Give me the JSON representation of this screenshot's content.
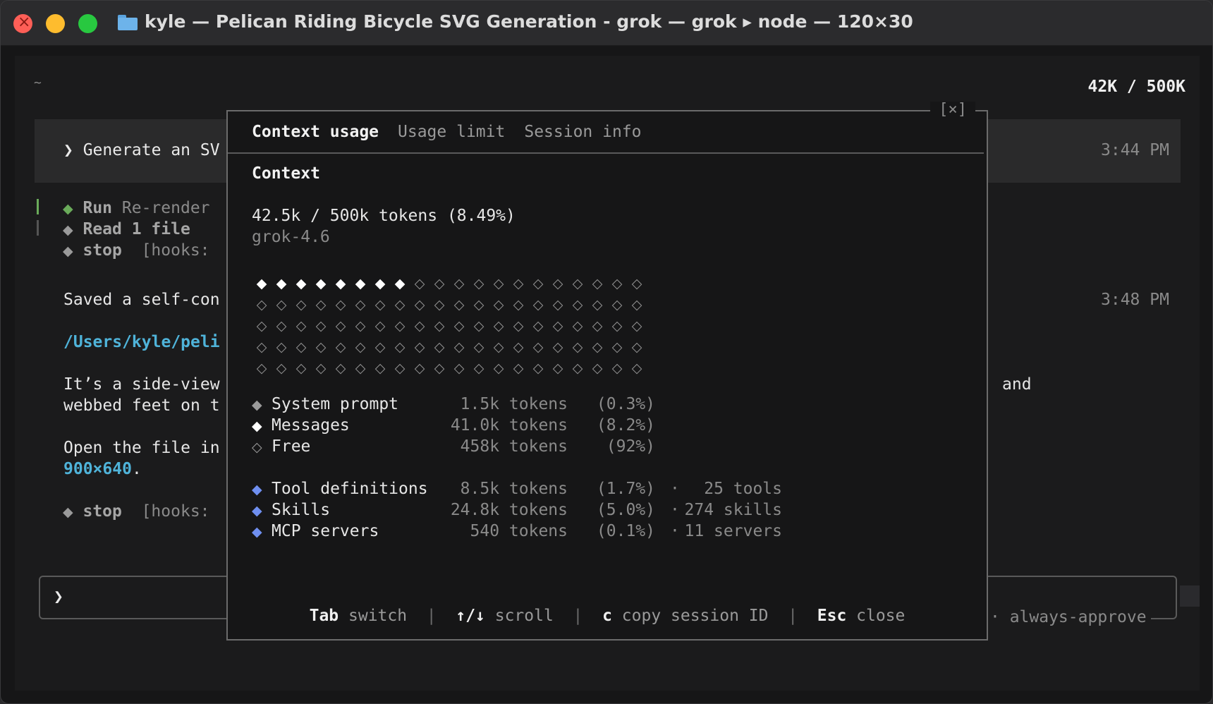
{
  "window": {
    "title": "kyle — Pelican Riding Bicycle SVG Generation - grok — grok ▸ node — 120×30"
  },
  "terminal": {
    "cwd": "~",
    "token_counter": "42K / 500K",
    "user_prompt": "❯ Generate an SV",
    "user_time": "3:44 PM",
    "steps": [
      {
        "verb": "Run",
        "text": "Re-render"
      },
      {
        "verb": "Read 1 file",
        "text": ""
      },
      {
        "verb": "stop",
        "text": "[hooks:"
      }
    ],
    "response_line1": "Saved a self-con",
    "response_time": "3:48 PM",
    "file_path": "/Users/kyle/peli",
    "desc_line1": "It’s a side-view",
    "desc_line1_tail": "and",
    "desc_line2": "webbed feet on t",
    "open_line": "Open the file in",
    "dimensions": "900×640",
    "dimensions_tail": ".",
    "final_stop": {
      "verb": "stop",
      "text": "[hooks:"
    },
    "input_prompt": "❯",
    "mode_label": "· always-approve"
  },
  "modal": {
    "close": "[×]",
    "tabs": [
      "Context usage",
      "Usage limit",
      "Session info"
    ],
    "section_title": "Context",
    "usage_line": "42.5k / 500k tokens (8.49%)",
    "model": "grok-4.6",
    "grid": {
      "rows": 5,
      "cols": 20,
      "filled": 8,
      "filled_fraction": 0.0849
    },
    "breakdown": [
      {
        "icon": "◆",
        "label": "System prompt",
        "tokens": "1.5k tokens",
        "pct": "(0.3%)"
      },
      {
        "icon": "◆",
        "label": "Messages",
        "tokens": "41.0k tokens",
        "pct": "(8.2%)"
      },
      {
        "icon": "◇",
        "label": "Free",
        "tokens": "458k tokens",
        "pct": "(92%)"
      }
    ],
    "extras": [
      {
        "icon": "◆",
        "label": "Tool definitions",
        "tokens": "8.5k tokens",
        "pct": "(1.7%)",
        "sep": "·",
        "count": "25 tools"
      },
      {
        "icon": "◆",
        "label": "Skills",
        "tokens": "24.8k tokens",
        "pct": "(5.0%)",
        "sep": "·",
        "count": "274 skills"
      },
      {
        "icon": "◆",
        "label": "MCP servers",
        "tokens": "540 tokens",
        "pct": "(0.1%)",
        "sep": "·",
        "count": "11 servers"
      }
    ],
    "footer": [
      {
        "key": "Tab",
        "desc": "switch"
      },
      {
        "key": "↑/↓",
        "desc": "scroll"
      },
      {
        "key": "c",
        "desc": "copy session ID"
      },
      {
        "key": "Esc",
        "desc": "close"
      }
    ],
    "footer_sep": "|"
  }
}
